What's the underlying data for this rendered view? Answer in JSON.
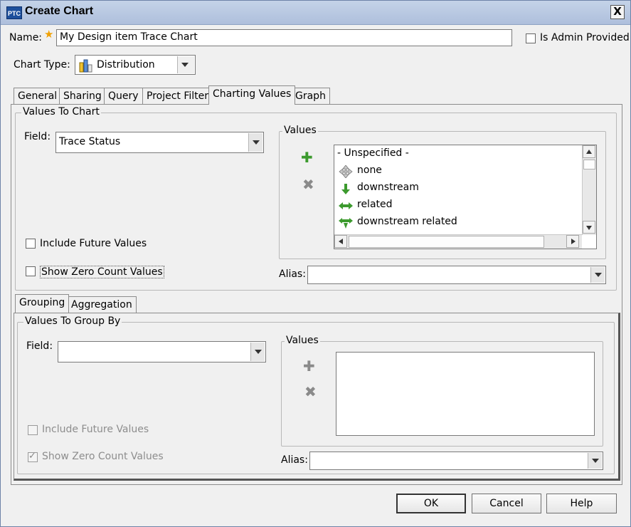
{
  "window": {
    "logo": "PTC",
    "title": "Create Chart",
    "close_glyph": "X"
  },
  "name_row": {
    "label": "Name:",
    "required_mark": "★",
    "value": "My Design item Trace Chart",
    "admin_label": "Is Admin Provided"
  },
  "chart_type": {
    "label": "Chart Type:",
    "value": "Distribution"
  },
  "tabs": [
    {
      "label": "General"
    },
    {
      "label": "Sharing"
    },
    {
      "label": "Query"
    },
    {
      "label": "Project Filter"
    },
    {
      "label": "Charting Values"
    },
    {
      "label": "Graph"
    }
  ],
  "values_to_chart": {
    "title": "Values To Chart",
    "field_label": "Field:",
    "field_value": "Trace Status",
    "include_future": "Include Future Values",
    "show_zero": "Show Zero Count Values",
    "values_title": "Values",
    "items": [
      {
        "label": "- Unspecified -",
        "icon": "none"
      },
      {
        "label": "none",
        "icon": "move-arrows-icon"
      },
      {
        "label": "downstream",
        "icon": "down-arrow-icon"
      },
      {
        "label": "related",
        "icon": "double-arrow-icon"
      },
      {
        "label": "downstream related",
        "icon": "downstream-related-icon"
      }
    ],
    "alias_label": "Alias:"
  },
  "sub_tabs": [
    {
      "label": "Grouping"
    },
    {
      "label": "Aggregation"
    }
  ],
  "values_to_group": {
    "title": "Values To Group By",
    "field_label": "Field:",
    "include_future": "Include Future Values",
    "show_zero": "Show Zero Count Values",
    "values_title": "Values",
    "alias_label": "Alias:"
  },
  "buttons": {
    "ok": "OK",
    "cancel": "Cancel",
    "help": "Help"
  },
  "colors": {
    "accent_green": "#3c9a2e",
    "title_bar": "#b9c9e2"
  }
}
